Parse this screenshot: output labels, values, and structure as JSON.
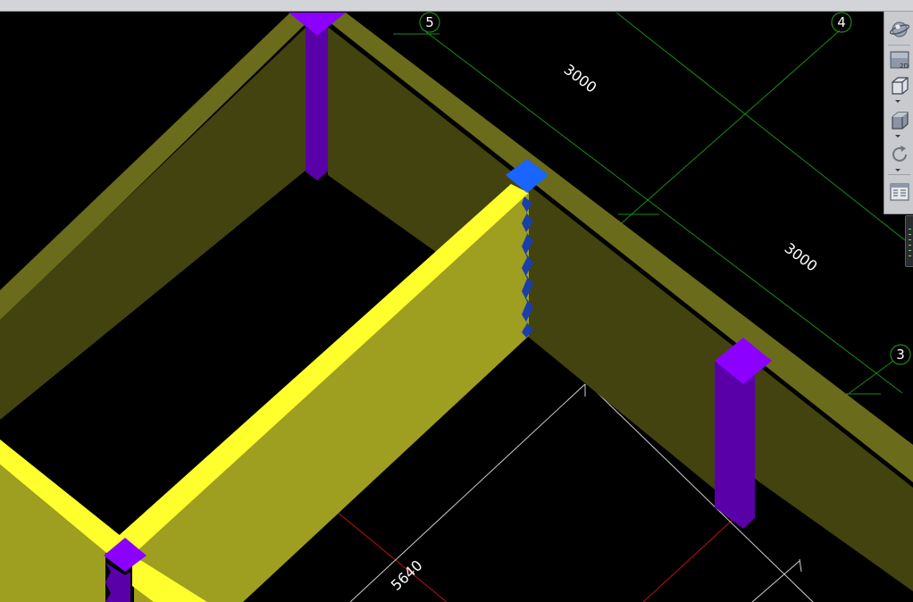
{
  "viewport": {
    "background_color": "#000000",
    "grid_labels": [
      "5",
      "4",
      "3"
    ],
    "dimension_labels": [
      "3000",
      "3000",
      "5640"
    ]
  },
  "colors": {
    "wall_top": "#6b6b1c",
    "wall_side": "#43430f",
    "beam_top": "#ffff2e",
    "beam_side": "#9e9e20",
    "column_top": "#8b00ff",
    "column_side": "#5a00a8",
    "column_selected": "#1a64ff",
    "grid_axis": "#1a8a1a",
    "red_axis": "#c01010",
    "dimension_line": "#cfcfcf"
  },
  "nav_bar": {
    "buttons": [
      {
        "name": "steering-wheel-icon"
      },
      {
        "name": "2d-view-icon",
        "text": "2D"
      },
      {
        "name": "wireframe-cube-icon"
      },
      {
        "name": "shaded-cube-icon"
      },
      {
        "name": "orbit-icon"
      },
      {
        "name": "view-manager-icon"
      }
    ]
  }
}
